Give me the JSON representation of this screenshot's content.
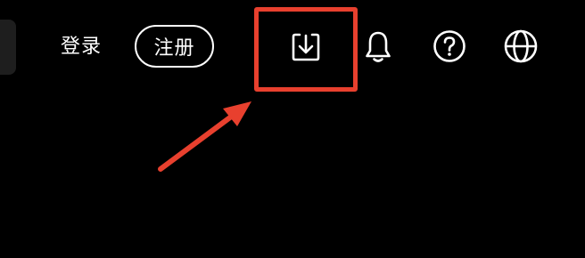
{
  "header": {
    "login_label": "登录",
    "register_label": "注册",
    "icons": [
      "download-icon",
      "bell-icon",
      "help-icon",
      "globe-icon"
    ]
  },
  "annotation": {
    "color": "#e8402e"
  },
  "colors": {
    "background": "#000000",
    "foreground": "#ffffff"
  }
}
